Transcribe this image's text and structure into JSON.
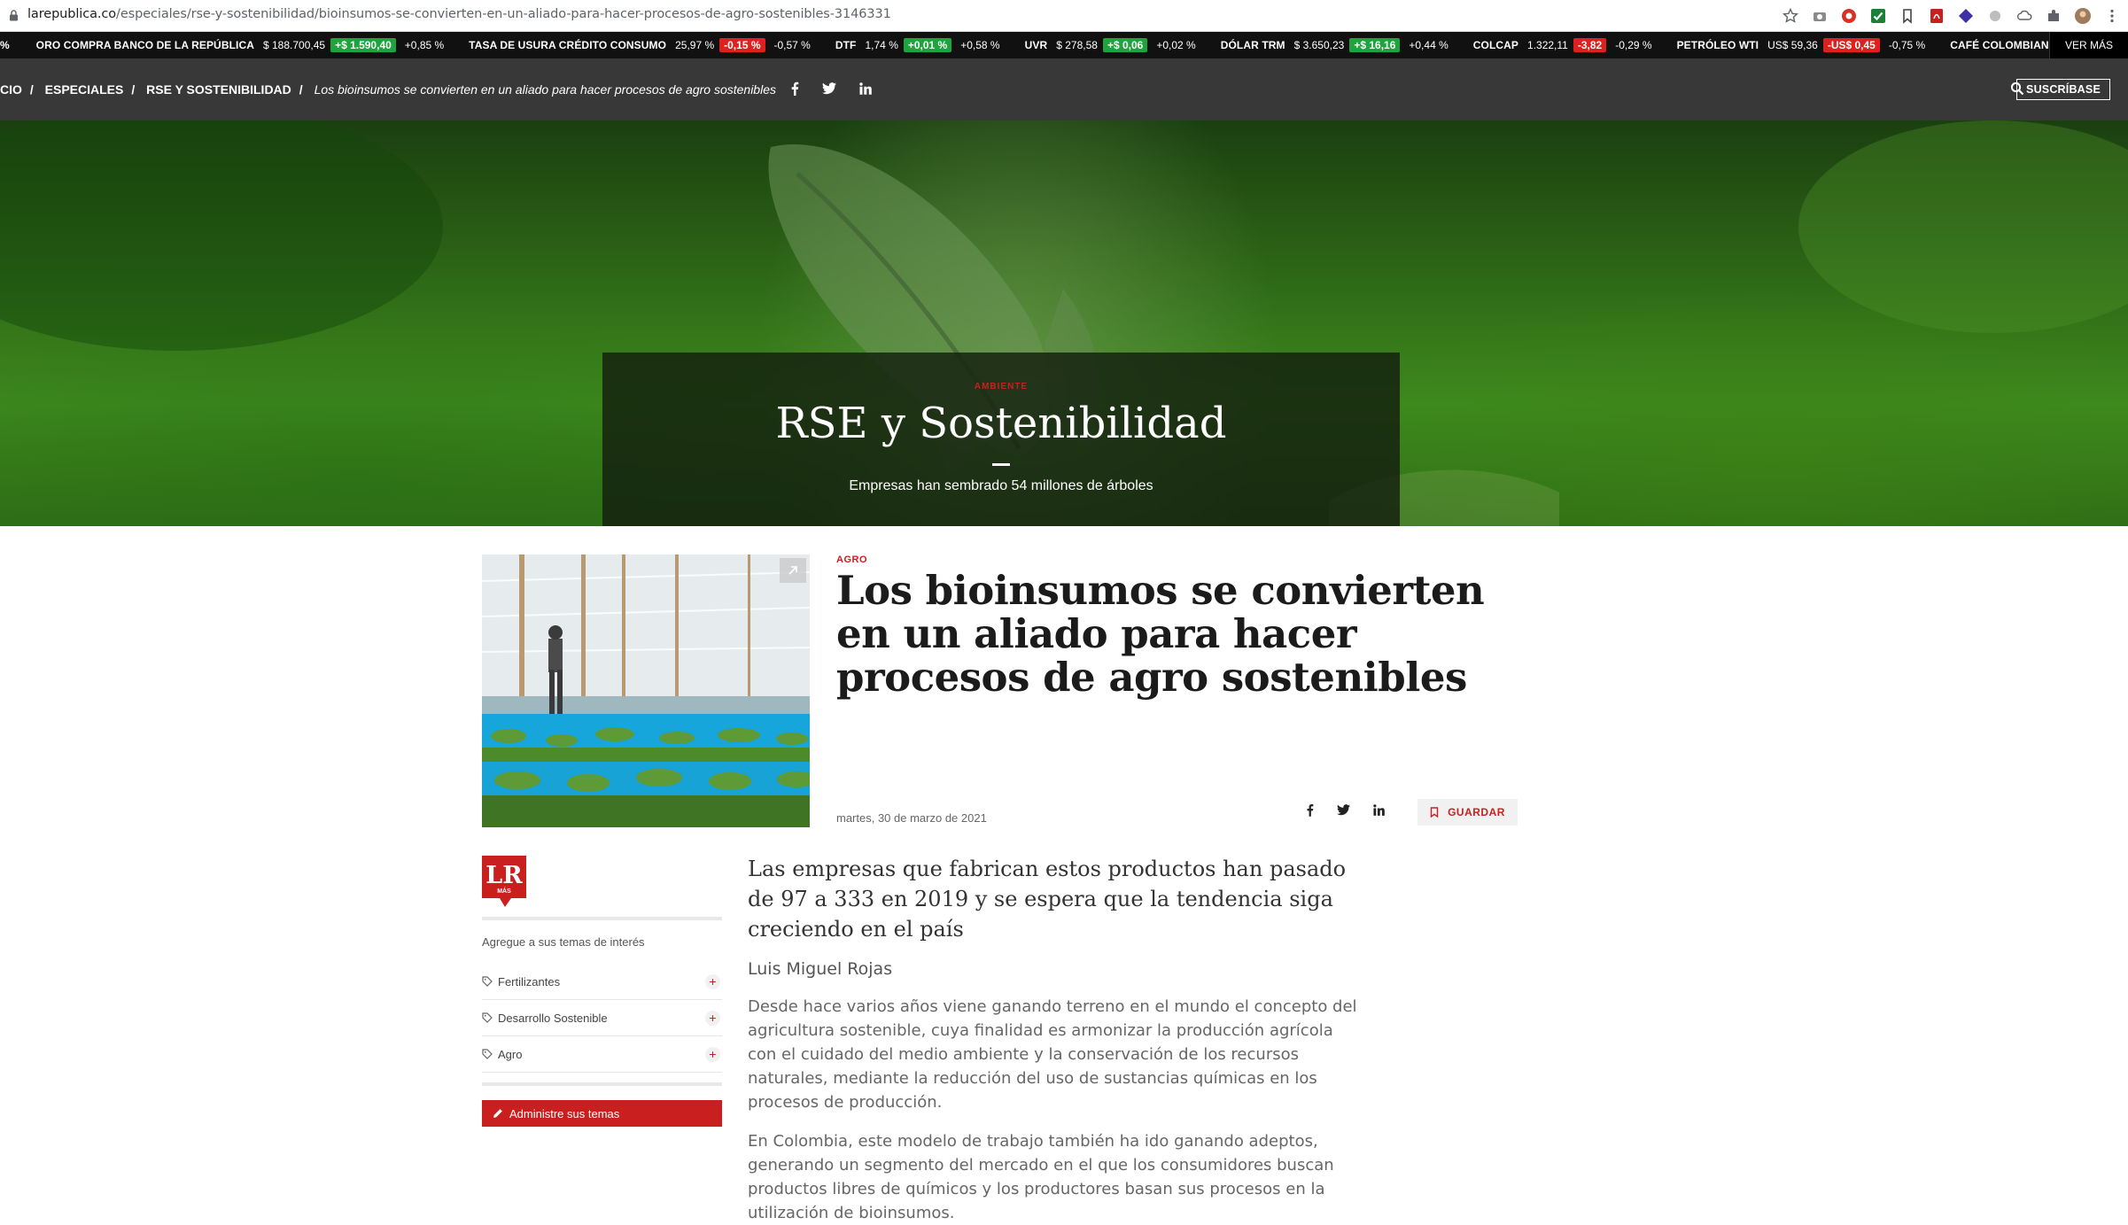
{
  "browser": {
    "url_host": "larepublica.co",
    "url_path": "/especiales/rse-y-sostenibilidad/bioinsumos-se-convierten-en-un-aliado-para-hacer-procesos-de-agro-sostenibles-3146331"
  },
  "ticker": {
    "leading_fragment": "%",
    "items": [
      {
        "name": "ORO COMPRA BANCO DE LA REPÚBLICA",
        "value": "$ 188.700,45",
        "change": "+$ 1.590,40",
        "direction": "up",
        "pct": "+0,85 %"
      },
      {
        "name": "TASA DE USURA CRÉDITO CONSUMO",
        "value": "25,97 %",
        "change": "-0,15 %",
        "direction": "down",
        "pct": "-0,57 %"
      },
      {
        "name": "DTF",
        "value": "1,74 %",
        "change": "+0,01 %",
        "direction": "up",
        "pct": "+0,58 %"
      },
      {
        "name": "UVR",
        "value": "$ 278,58",
        "change": "+$ 0,06",
        "direction": "up",
        "pct": "+0,02 %"
      },
      {
        "name": "DÓLAR TRM",
        "value": "$ 3.650,23",
        "change": "+$ 16,16",
        "direction": "up",
        "pct": "+0,44 %"
      },
      {
        "name": "COLCAP",
        "value": "1.322,11",
        "change": "-3,82",
        "direction": "down",
        "pct": "-0,29 %"
      },
      {
        "name": "PETRÓLEO WTI",
        "value": "US$ 59,36",
        "change": "-US$ 0,45",
        "direction": "down",
        "pct": "-0,75 %"
      },
      {
        "name": "CAFÉ COLOMBIAN MI",
        "value": "",
        "change": "",
        "direction": "",
        "pct": ""
      }
    ],
    "more_label": "VER MÁS",
    "colors": {
      "up": "#1fa33c",
      "down": "#e0201d"
    }
  },
  "nav": {
    "crumbs": [
      "CIO",
      "ESPECIALES",
      "RSE Y SOSTENIBILIDAD"
    ],
    "separator": "/",
    "current": "Los bioinsumos se convierten en un aliado para hacer procesos de agro sostenibles",
    "subscribe_label": "SUSCRÍBASE"
  },
  "hero": {
    "kicker": "AMBIENTE",
    "title": "RSE y Sostenibilidad",
    "subtitle": "Empresas han sembrado 54 millones de árboles"
  },
  "article": {
    "category": "AGRO",
    "headline": "Los bioinsumos se convierten en un aliado para hacer procesos de agro sostenibles",
    "date": "martes, 30 de marzo de 2021",
    "save_label": "GUARDAR",
    "lead": "Las empresas que fabrican estos productos han pasado de 97 a 333 en 2019 y se espera que la tendencia siga creciendo en el país",
    "author": "Luis Miguel Rojas",
    "paragraphs": [
      "Desde hace varios años viene ganando terreno en el mundo el concepto del agricultura sostenible, cuya finalidad es armonizar la producción agrícola con el cuidado del medio ambiente y la conservación de los recursos naturales, mediante la reducción del uso de sustancias químicas en los procesos de producción.",
      "En Colombia, este modelo de trabajo también ha ido ganando adeptos, generando un segmento del mercado en el que los consumidores buscan productos libres de químicos y los productores basan sus procesos en la utilización de bioinsumos."
    ]
  },
  "sidebar": {
    "logo_text": "LR",
    "logo_sub": "MÁS",
    "intro": "Agregue a sus temas de interés",
    "topics": [
      {
        "label": "Fertilizantes",
        "action": "+"
      },
      {
        "label": "Desarrollo Sostenible",
        "action": "+"
      },
      {
        "label": "Agro",
        "action": "+"
      }
    ],
    "manage_label": "Administre sus temas"
  },
  "colors": {
    "brand_red": "#c9201f",
    "nav_dark": "#383838",
    "ticker_bg": "#111111"
  }
}
